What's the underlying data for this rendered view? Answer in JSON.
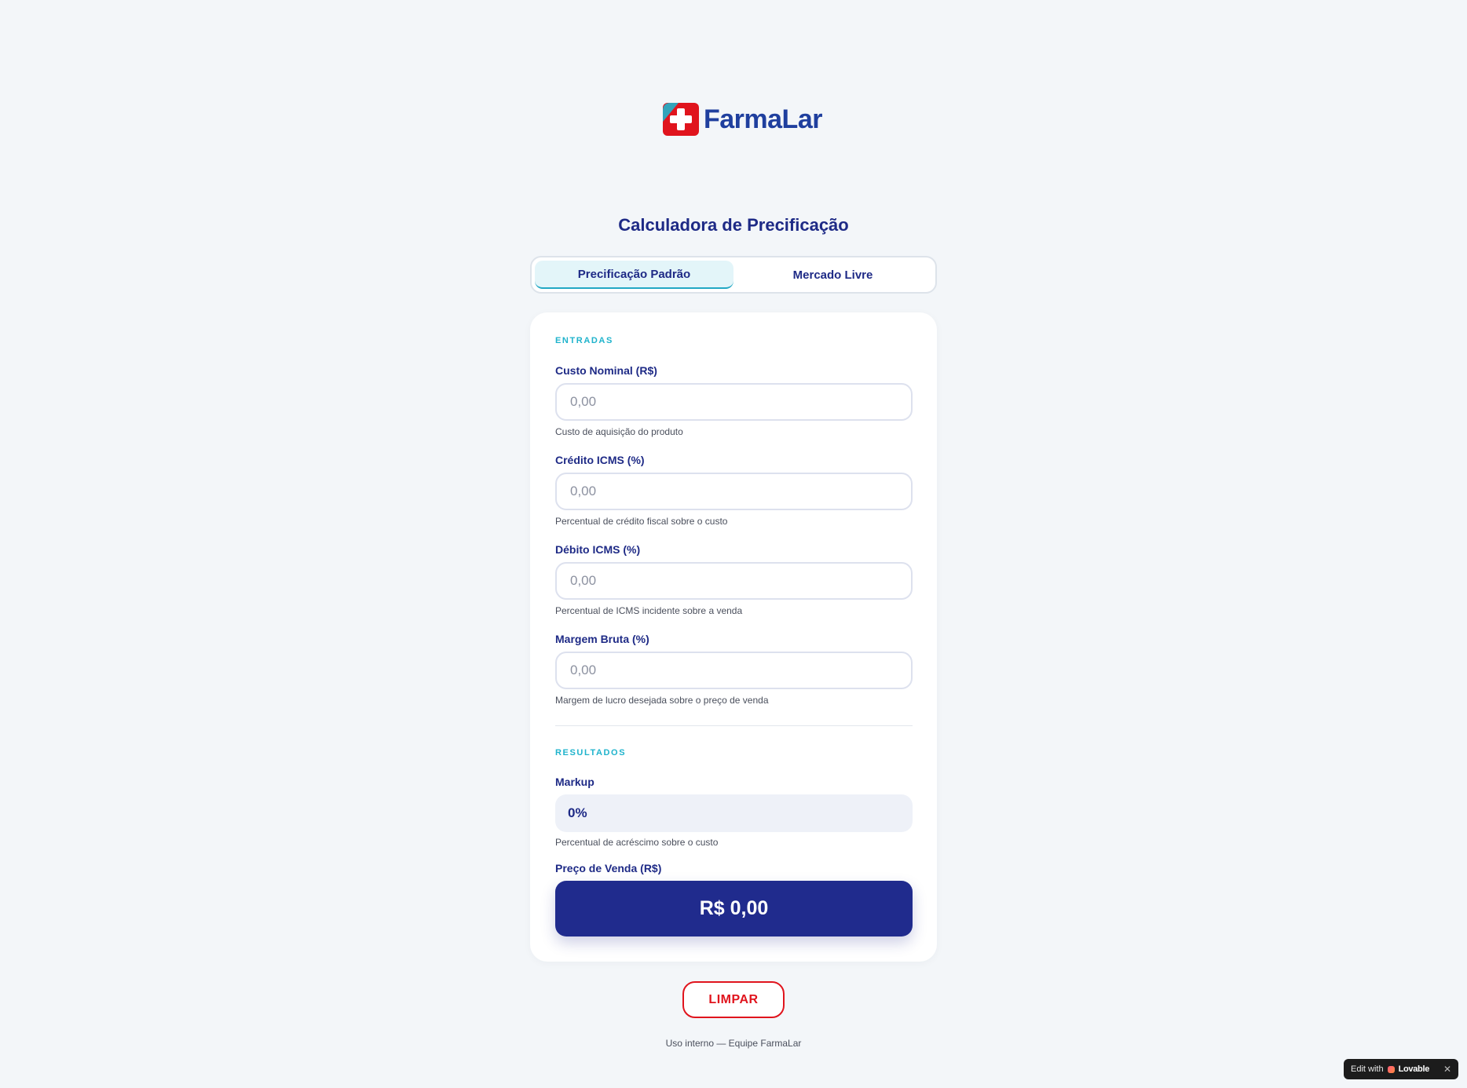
{
  "brand": {
    "name": "FarmaLar",
    "logo_icon": "medical-cross-icon",
    "colors": {
      "red": "#e0141d",
      "blue": "#1f3f9e"
    }
  },
  "page": {
    "title": "Calculadora de Precificação"
  },
  "tabs": [
    {
      "label": "Precificação Padrão",
      "active": true
    },
    {
      "label": "Mercado Livre",
      "active": false
    }
  ],
  "inputs": {
    "section_label": "ENTRADAS",
    "fields": [
      {
        "label": "Custo Nominal (R$)",
        "placeholder": "0,00",
        "value": "",
        "helper": "Custo de aquisição do produto"
      },
      {
        "label": "Crédito ICMS (%)",
        "placeholder": "0,00",
        "value": "",
        "helper": "Percentual de crédito fiscal sobre o custo"
      },
      {
        "label": "Débito ICMS (%)",
        "placeholder": "0,00",
        "value": "",
        "helper": "Percentual de ICMS incidente sobre a venda"
      },
      {
        "label": "Margem Bruta (%)",
        "placeholder": "0,00",
        "value": "",
        "helper": "Margem de lucro desejada sobre o preço de venda"
      }
    ]
  },
  "results": {
    "section_label": "RESULTADOS",
    "markup": {
      "label": "Markup",
      "value": "0%",
      "helper": "Percentual de acréscimo sobre o custo"
    },
    "price": {
      "label": "Preço de Venda (R$)",
      "value": "R$ 0,00"
    }
  },
  "actions": {
    "clear_label": "LIMPAR"
  },
  "footer": {
    "text": "Uso interno — Equipe FarmaLar"
  },
  "badge": {
    "prefix": "Edit with",
    "brand": "Lovable",
    "close_icon": "close-icon",
    "close_glyph": "✕"
  },
  "theme": {
    "primary": "#1e2a86",
    "accent": "#1fb3cc",
    "danger": "#e0141d",
    "price_bg": "#202b8d"
  }
}
